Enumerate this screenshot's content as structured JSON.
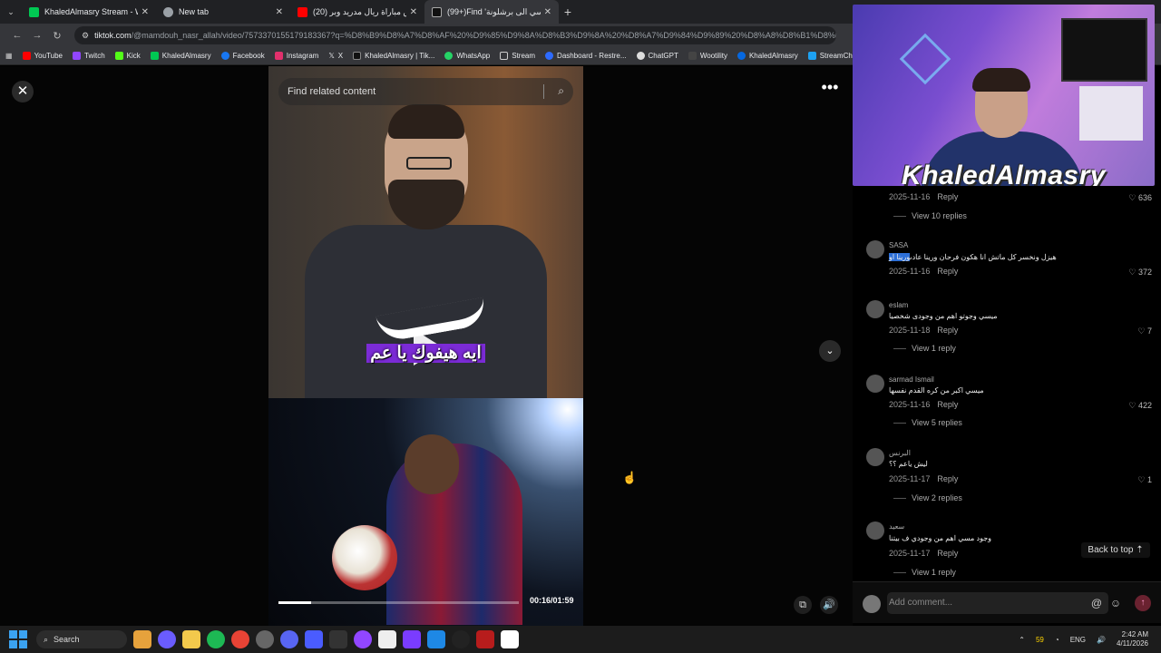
{
  "browser": {
    "tabs": [
      {
        "title": "KhaledAlmasry Stream - Watch",
        "color": "#00c853"
      },
      {
        "title": "New tab",
        "color": "#9aa0a6"
      },
      {
        "title": "(20) ملخص مباراة ريال مدريد وبر",
        "color": "#ff0000"
      },
      {
        "title": "(99+)Find 'عاد ميسي الى برشلونة",
        "color": "#111111"
      }
    ],
    "url_host": "tiktok.com",
    "url_path": "/@mamdouh_nasr_allah/video/7573370155179183367?q=%D8%B9%D8%A7%D8%AF%20%D9%85%D9%8A%D8%B3%D9%8A%20%D8%A7%D9%84%D9%89%20%D8%A8%D8%B1%D8%B4%D9%84%D9%88%D9%86%D8%A9&t=1775867537967",
    "bookmarks": [
      {
        "label": "YouTube",
        "color": "#ff0000"
      },
      {
        "label": "Twitch",
        "color": "#9146ff"
      },
      {
        "label": "Kick",
        "color": "#53fc18"
      },
      {
        "label": "KhaledAlmasry",
        "color": "#00c853"
      },
      {
        "label": "Facebook",
        "color": "#1877f2"
      },
      {
        "label": "Instagram",
        "color": "#e1306c"
      },
      {
        "label": "X",
        "color": "#ffffff"
      },
      {
        "label": "KhaledAlmasry | Tik...",
        "color": "#111111"
      },
      {
        "label": "WhatsApp",
        "color": "#25d366"
      },
      {
        "label": "Stream",
        "color": "#888888"
      },
      {
        "label": "Dashboard - Restre...",
        "color": "#2d6bff"
      },
      {
        "label": "ChatGPT",
        "color": "#dddddd"
      },
      {
        "label": "Wootility",
        "color": "#444444"
      },
      {
        "label": "KhaledAlmasry",
        "color": "#0668e1"
      },
      {
        "label": "StreamCharts",
        "color": "#1da1f2"
      }
    ]
  },
  "viewer": {
    "search_placeholder": "Find related content",
    "caption": "ايه هيفوك يا عم",
    "time": "00:16/01:59",
    "progress": 0.134
  },
  "webcam": {
    "name": "KhaledAlmasry"
  },
  "comments": [
    {
      "user": "",
      "text": "",
      "date": "2025-11-16",
      "reply": "Reply",
      "likes": "636",
      "replies": "View 10 replies"
    },
    {
      "user": "SASA",
      "text_highlight": "ورينا او",
      "text": " هيزل ونخسر كل ماتش انا هكون فرحان ورينا عادى",
      "date": "2025-11-16",
      "reply": "Reply",
      "likes": "372",
      "replies": ""
    },
    {
      "user": "eslam",
      "text": "ميسي وجوتو اهم من وجودى شخصيا",
      "date": "2025-11-18",
      "reply": "Reply",
      "likes": "7",
      "replies": "View 1 reply"
    },
    {
      "user": "sarmad Ismail",
      "text": "ميسي اكبر من كره القدم نفسها",
      "date": "2025-11-16",
      "reply": "Reply",
      "likes": "422",
      "replies": "View 5 replies"
    },
    {
      "user": "البرنس",
      "text": "ليش ياعم ؟؟",
      "date": "2025-11-17",
      "reply": "Reply",
      "likes": "1",
      "replies": "View 2 replies"
    },
    {
      "user": "سعيد",
      "text": "وجود مسي اهم من وجودي ف بيتنا",
      "date": "2025-11-17",
      "reply": "Reply",
      "likes": "",
      "replies": "View 1 reply"
    }
  ],
  "back_to_top": "Back to top ⇡",
  "comment_bar": {
    "placeholder": "Add comment..."
  },
  "taskbar": {
    "search": "Search",
    "tray_count": "59",
    "lang": "ENG",
    "time": "2:42 AM",
    "date": "4/11/2026"
  }
}
